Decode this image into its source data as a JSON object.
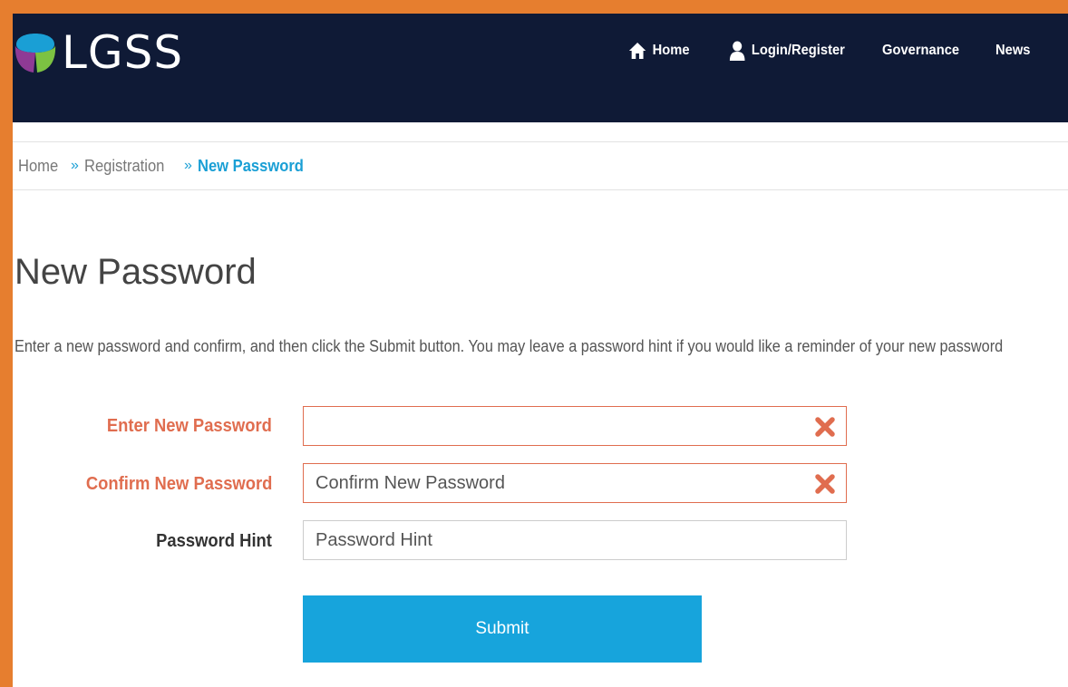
{
  "brand": {
    "name": "LGSS",
    "logo_colors": {
      "blue": "#1a9fd5",
      "green": "#7cc242",
      "purple": "#8e3a95"
    }
  },
  "nav": {
    "items": [
      {
        "label": "Home",
        "icon": "home-icon"
      },
      {
        "label": "Login/Register",
        "icon": "user-icon"
      },
      {
        "label": "Governance"
      },
      {
        "label": "News"
      }
    ]
  },
  "breadcrumb": {
    "items": [
      "Home",
      "Registration",
      "New Password"
    ],
    "separator": "»"
  },
  "page": {
    "title": "New Password",
    "intro": "Enter a new password and confirm, and then click the Submit button. You may leave a password hint if you would like a reminder of your new password"
  },
  "form": {
    "fields": [
      {
        "label": "Enter New Password",
        "value": "",
        "placeholder": "",
        "state": "error",
        "icon": "close-icon"
      },
      {
        "label": "Confirm New Password",
        "value": "",
        "placeholder": "Confirm New Password",
        "state": "error",
        "icon": "close-icon"
      },
      {
        "label": "Password Hint",
        "value": "",
        "placeholder": "Password Hint",
        "state": "normal"
      }
    ],
    "submit_label": "Submit"
  },
  "colors": {
    "frame": "#e67e2f",
    "header_bg": "#0f1a36",
    "accent": "#17a4dc",
    "error": "#e06d4f"
  }
}
